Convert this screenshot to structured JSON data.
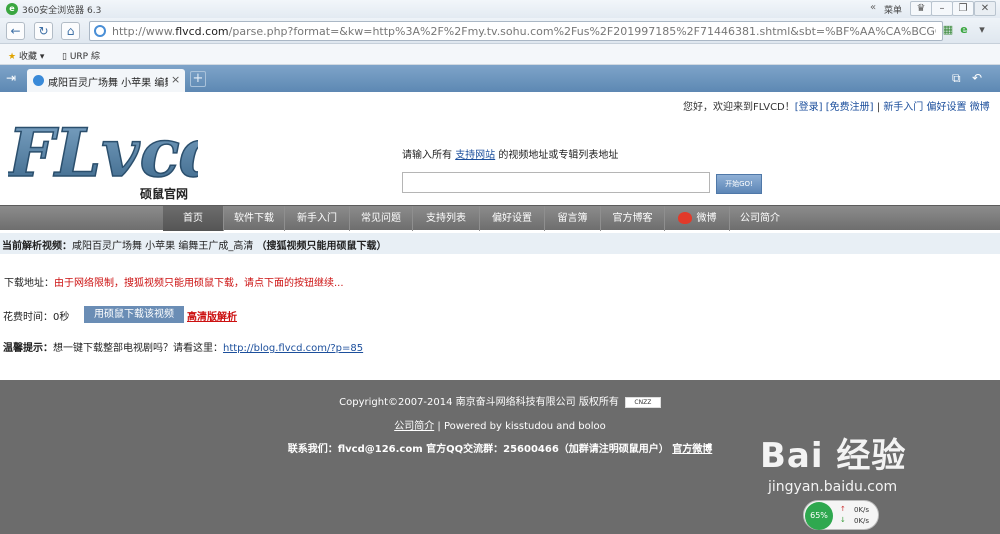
{
  "browser": {
    "title": "360安全浏览器 6.3",
    "menu_label": "菜单",
    "url_prefix": "http://www.",
    "url_host": "flvcd.com",
    "url_rest": "/parse.php?format=&kw=http%3A%2F%2Fmy.tv.sohu.com%2Fus%2F201997185%2F71446381.shtml&sbt=%BF%AA%CA%BCGO%21",
    "bookmarks": [
      "收藏",
      "URP 綜"
    ],
    "tab_title": "咸阳百灵广场舞 小苹果 编舞王",
    "tab_close": "×",
    "tab_new": "+"
  },
  "header": {
    "welcome_text": "您好，欢迎来到FLVCD！",
    "login": "[登录]",
    "register": "[免费注册]",
    "sep": "|",
    "newbie": "新手入门",
    "prefs": "偏好设置",
    "weibo": "微博",
    "brand_sub": "硕鼠官网"
  },
  "search": {
    "prompt_pre": "请输入所有",
    "prompt_link": "支持网站",
    "prompt_post": "的视频地址或专辑列表地址",
    "value": "",
    "button": "开始GO!"
  },
  "nav": [
    "首页",
    "软件下载",
    "新手入门",
    "常见问题",
    "支持列表",
    "偏好设置",
    "留言簿",
    "官方博客",
    "微博",
    "公司简介"
  ],
  "result": {
    "current_label": "当前解析视频：",
    "video_title": "咸阳百灵广场舞 小苹果 编舞王广成_高清",
    "note": "（搜狐视频只能用硕鼠下载）",
    "download_label": "下载地址：",
    "download_msg": "由于网络限制，搜狐视频只能用硕鼠下载，请点下面的按钮继续...",
    "time_label": "花费时间：0秒",
    "download_button": "用硕鼠下载该视频",
    "hd_link": "高清版解析",
    "tip_label": "温馨提示：",
    "tip_text": "想一键下载整部电视剧吗？请看这里：",
    "tip_link": "http://blog.flvcd.com/?p=85"
  },
  "footer": {
    "copyright": "Copyright©2007-2014 南京奋斗网络科技有限公司 版权所有",
    "cnzz": "CNZZ",
    "company_link": "公司简介",
    "powered": "| Powered by kisstudou and boloo",
    "contact": "联系我们：flvcd@126.com 官方QQ交流群：25600466（加群请注明硕鼠用户）",
    "weibo_link": "官方微博"
  },
  "overlay": {
    "wm_main": "Bai 经验",
    "wm_sub": "jingyan.baidu.com",
    "net_percent": "65%",
    "up_speed": "0K/s",
    "down_speed": "0K/s"
  }
}
